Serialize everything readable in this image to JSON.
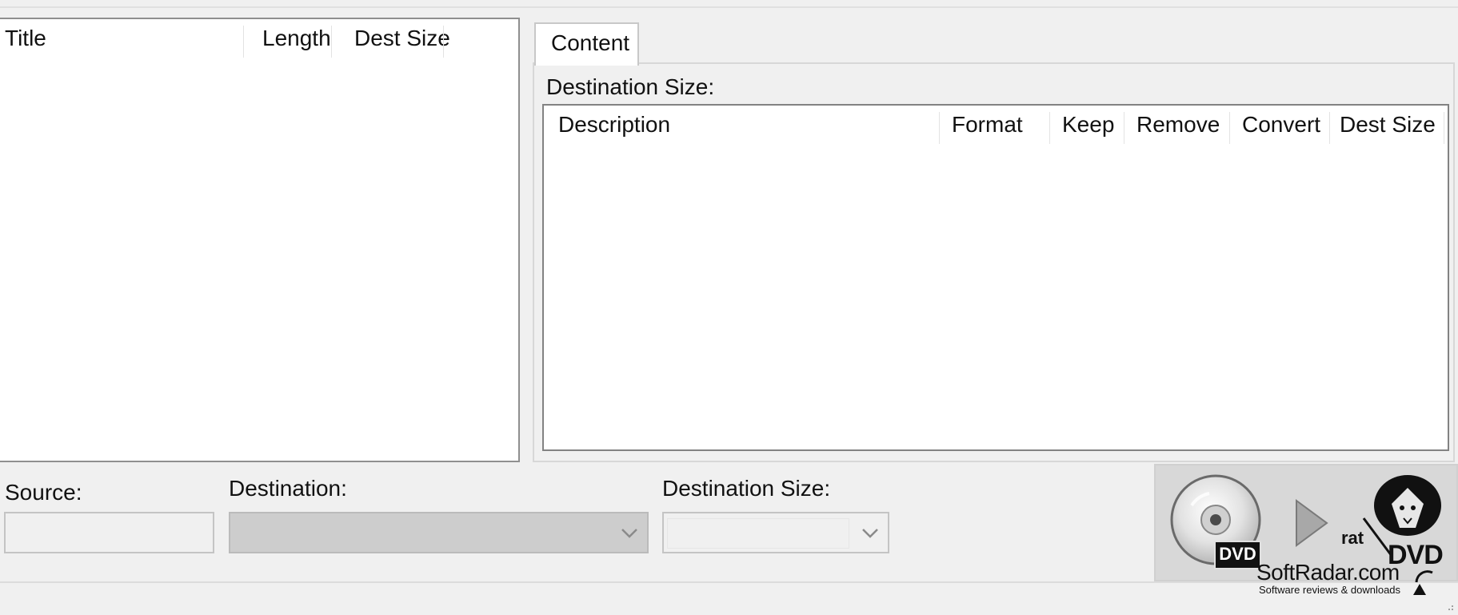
{
  "titles_list": {
    "columns": [
      "Title",
      "Length",
      "Dest Size"
    ]
  },
  "content_tab": {
    "label": "Content",
    "destination_size_label": "Destination Size:",
    "columns": [
      "Description",
      "Format",
      "Keep",
      "Remove",
      "Convert",
      "Dest Size"
    ]
  },
  "bottom": {
    "source_label": "Source:",
    "source_value": "",
    "destination_label": "Destination:",
    "destination_value": "",
    "destination_size_label": "Destination Size:",
    "destination_size_value": ""
  },
  "action_panel": {
    "source_icon": "dvd-disc-icon",
    "source_badge": "DVD",
    "arrow_icon": "play-arrow-icon",
    "dest_logo": "ratdvd-logo",
    "dest_logo_small": "rat",
    "dest_logo_big": "DVD"
  },
  "watermark": {
    "name": "SoftRadar.com",
    "tagline": "Software reviews & downloads"
  },
  "colors": {
    "window_bg": "#f0f0f0",
    "list_bg": "#ffffff",
    "disabled_combo": "#cdcdcd",
    "action_panel_bg": "#d8d8d8"
  }
}
